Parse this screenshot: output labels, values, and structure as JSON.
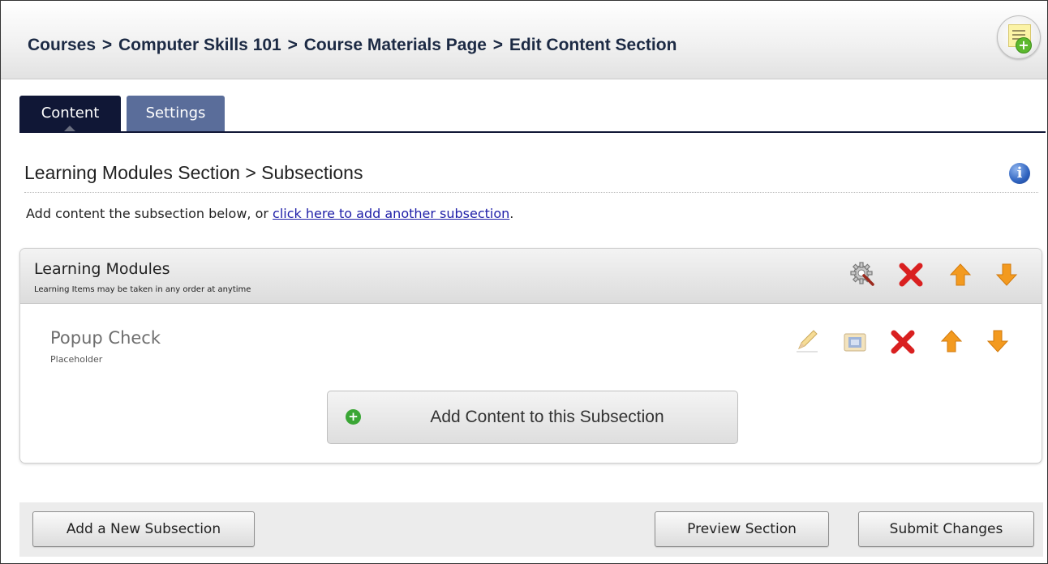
{
  "header": {
    "breadcrumb": [
      "Courses",
      "Computer Skills 101",
      "Course Materials Page",
      "Edit Content Section"
    ],
    "separator": ">",
    "badge_icon": "sticky-note-add-icon"
  },
  "tabs": [
    {
      "label": "Content",
      "active": true
    },
    {
      "label": "Settings",
      "active": false
    }
  ],
  "section": {
    "title": "Learning Modules Section > Subsections",
    "info_icon": "info-icon",
    "instruction_prefix": "Add content the subsection below, or ",
    "instruction_link": "click here to add another subsection",
    "instruction_suffix": "."
  },
  "subsection": {
    "title": "Learning Modules",
    "subtitle": "Learning Items may be taken in any order at anytime",
    "actions": [
      "settings-gear-icon",
      "delete-icon",
      "move-up-icon",
      "move-down-icon"
    ],
    "items": [
      {
        "title": "Popup Check",
        "subtitle": "Placeholder",
        "actions": [
          "edit-pencil-icon",
          "preview-icon",
          "delete-icon",
          "move-up-icon",
          "move-down-icon"
        ]
      }
    ],
    "add_button_label": "Add Content to this Subsection"
  },
  "footer": {
    "add_subsection": "Add a New Subsection",
    "preview": "Preview Section",
    "submit": "Submit Changes"
  },
  "colors": {
    "tab_active": "#101736",
    "tab_inactive": "#5a6d9a",
    "link": "#1e1ea8",
    "delete": "#d92020",
    "arrow": "#f39a1f",
    "add_green": "#3aa635"
  }
}
